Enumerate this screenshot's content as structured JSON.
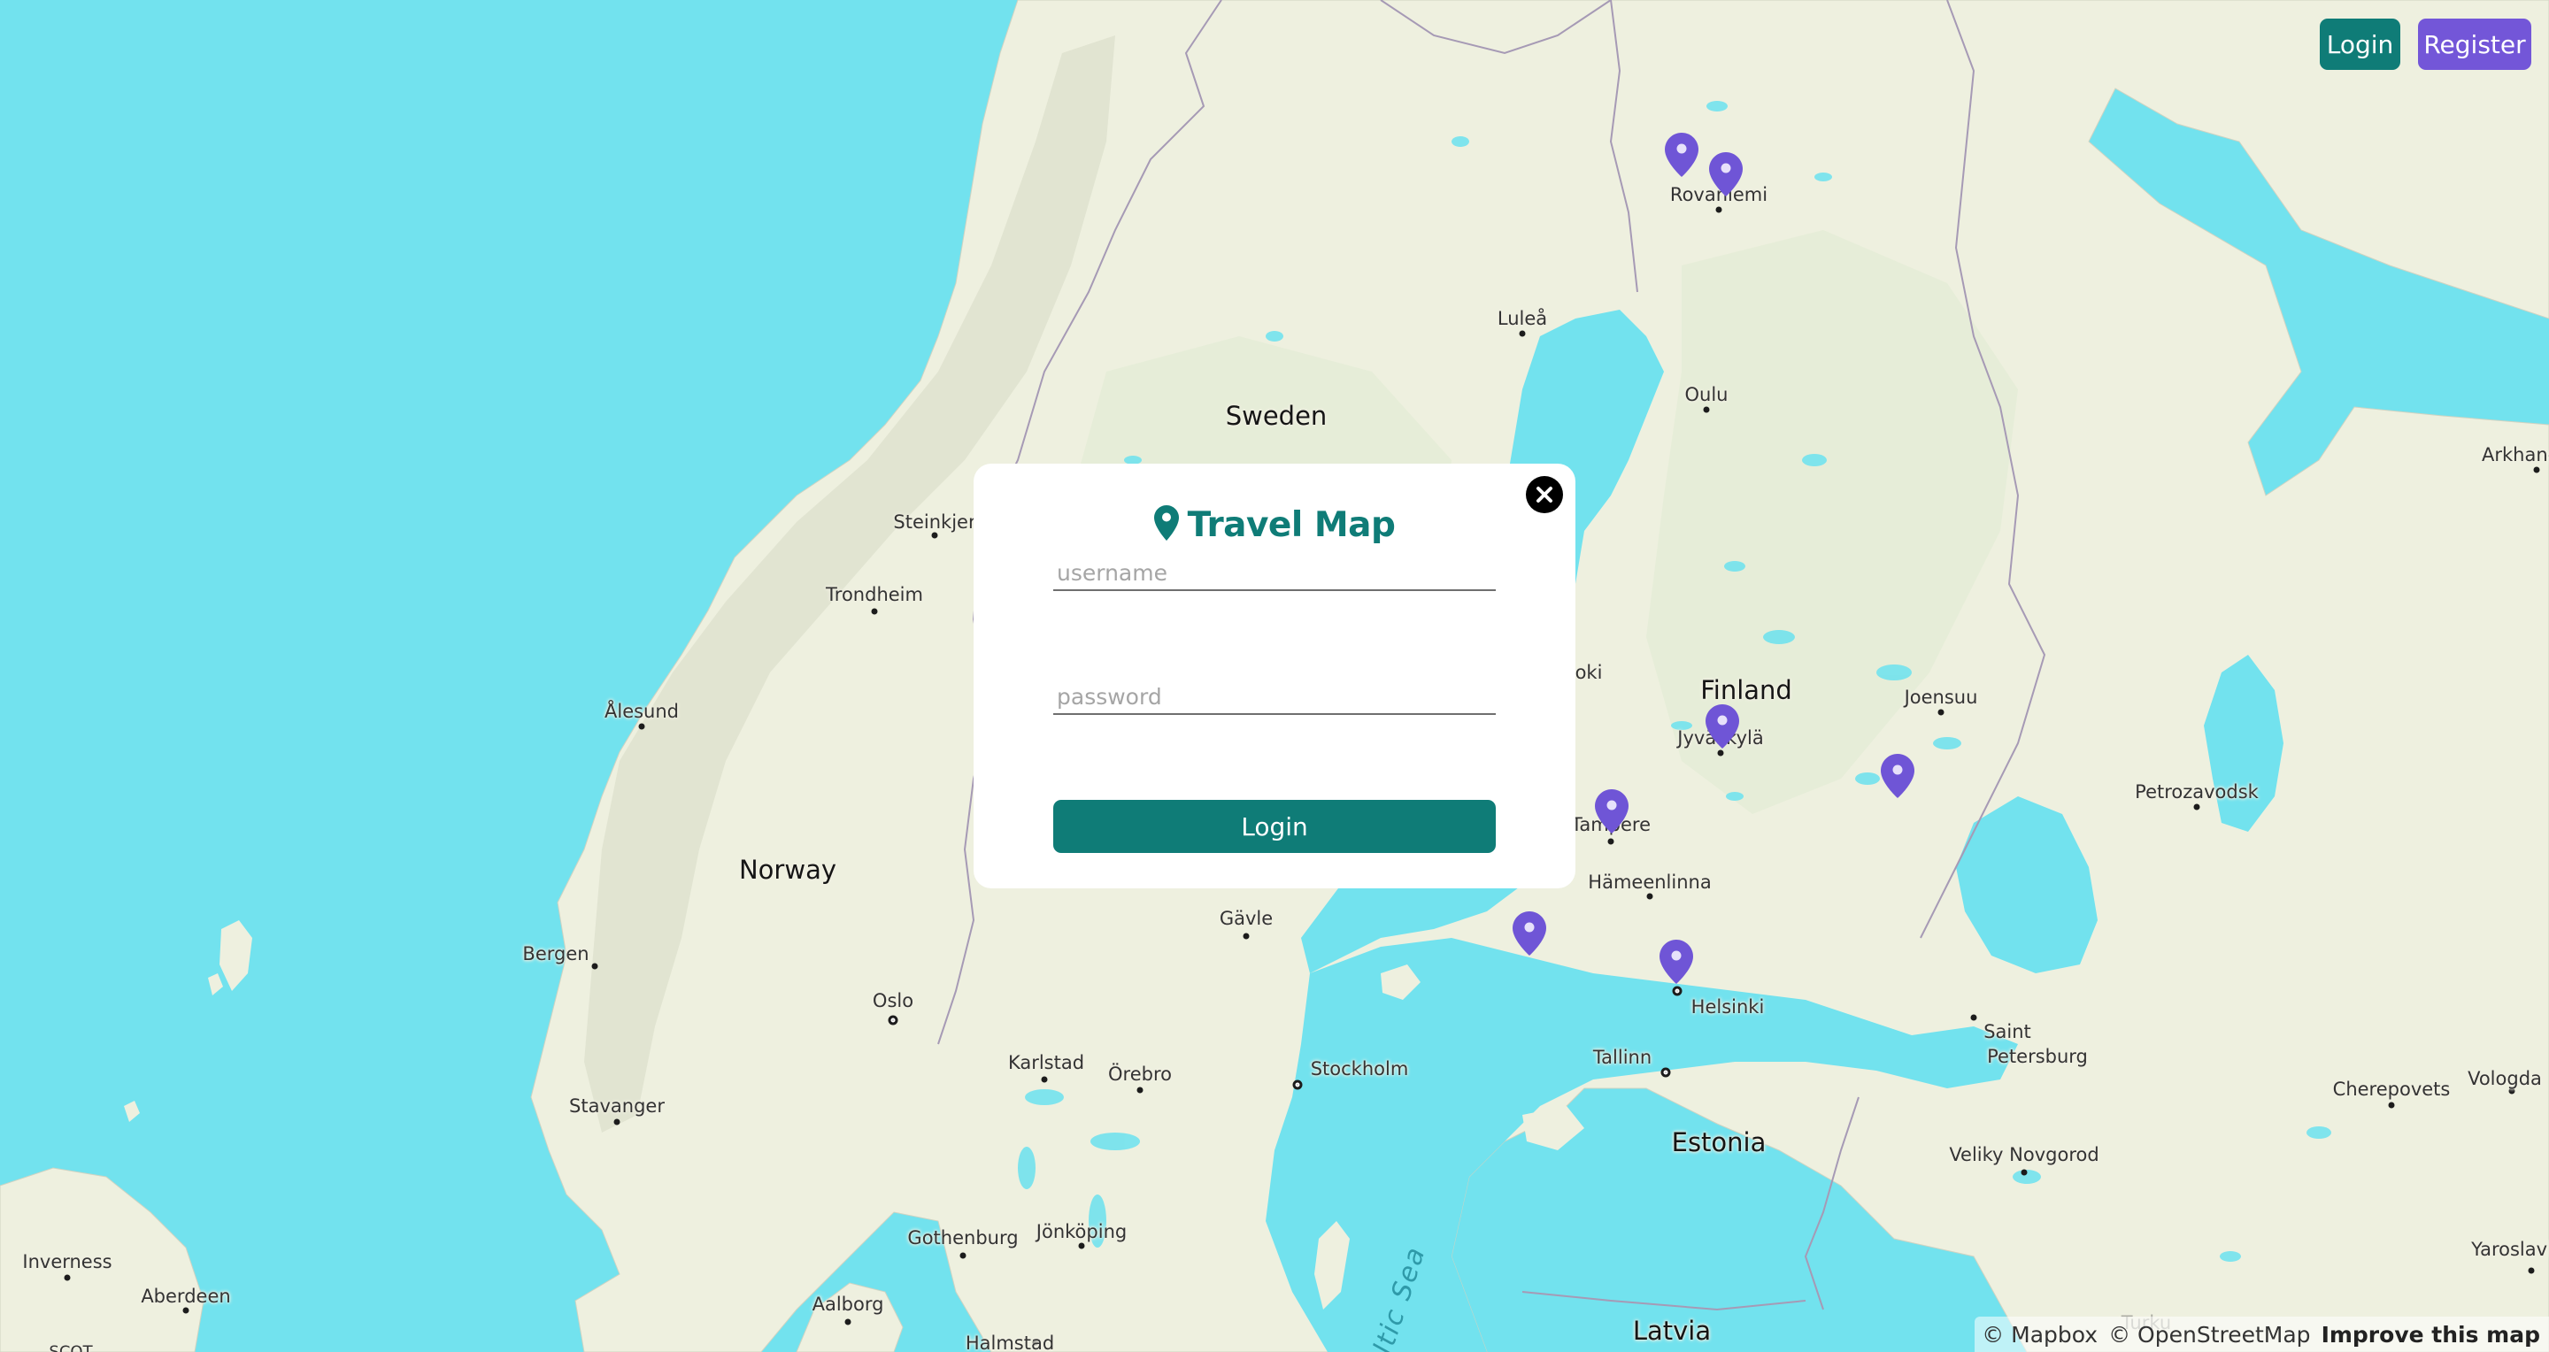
{
  "header": {
    "login_label": "Login",
    "register_label": "Register",
    "login_color": "#0f7c77",
    "register_color": "#7356d8"
  },
  "modal": {
    "title": "Travel Map",
    "title_icon": "map-pin-icon",
    "close_icon": "close-icon",
    "username_placeholder": "username",
    "password_placeholder": "password",
    "username_value": "",
    "password_value": "",
    "submit_label": "Login",
    "accent_color": "#0f7c77"
  },
  "map": {
    "pin_color": "#6f55d6",
    "water_color": "#72e2ee",
    "land_color": "#eef0df",
    "countries": {
      "sweden": "Sweden",
      "norway": "Norway",
      "finland": "Finland",
      "estonia": "Estonia",
      "latvia": "Latvia"
    },
    "sea": "Baltic Sea",
    "cities": {
      "rovaniemi": "Rovaniemi",
      "lulea": "Luleå",
      "oulu": "Oulu",
      "arkhangelsk": "Arkhang",
      "steinkjer": "Steinkjer",
      "trondheim": "Trondheim",
      "alesund": "Ålesund",
      "joensuu": "Joensuu",
      "jyvaskyla": "Jyväskylä",
      "vaasa_partial": "oki",
      "tampere": "Tampere",
      "petrozavodsk": "Petrozavodsk",
      "hameenlinna": "Hämeenlinna",
      "gavle": "Gävle",
      "bergen": "Bergen",
      "oslo": "Oslo",
      "helsinki": "Helsinki",
      "saint_petersburg_1": "Saint",
      "saint_petersburg_2": "Petersburg",
      "karlstad": "Karlstad",
      "orebro": "Örebro",
      "stockholm": "Stockholm",
      "tallinn": "Tallinn",
      "stavanger": "Stavanger",
      "cherepovets": "Cherepovets",
      "vologda": "Vologda",
      "veliky_novgorod": "Veliky Novgorod",
      "inverness": "Inverness",
      "aberdeen": "Aberdeen",
      "gothenburg": "Gothenburg",
      "jonkoping": "Jönköping",
      "yaroslavl": "Yaroslavl",
      "aalborg": "Aalborg",
      "halmstad": "Halmstad",
      "turku_partial": "Turku",
      "scot_partial": "SCOT"
    }
  },
  "attribution": {
    "mapbox": "© Mapbox",
    "osm": "© OpenStreetMap",
    "improve": "Improve this map"
  }
}
